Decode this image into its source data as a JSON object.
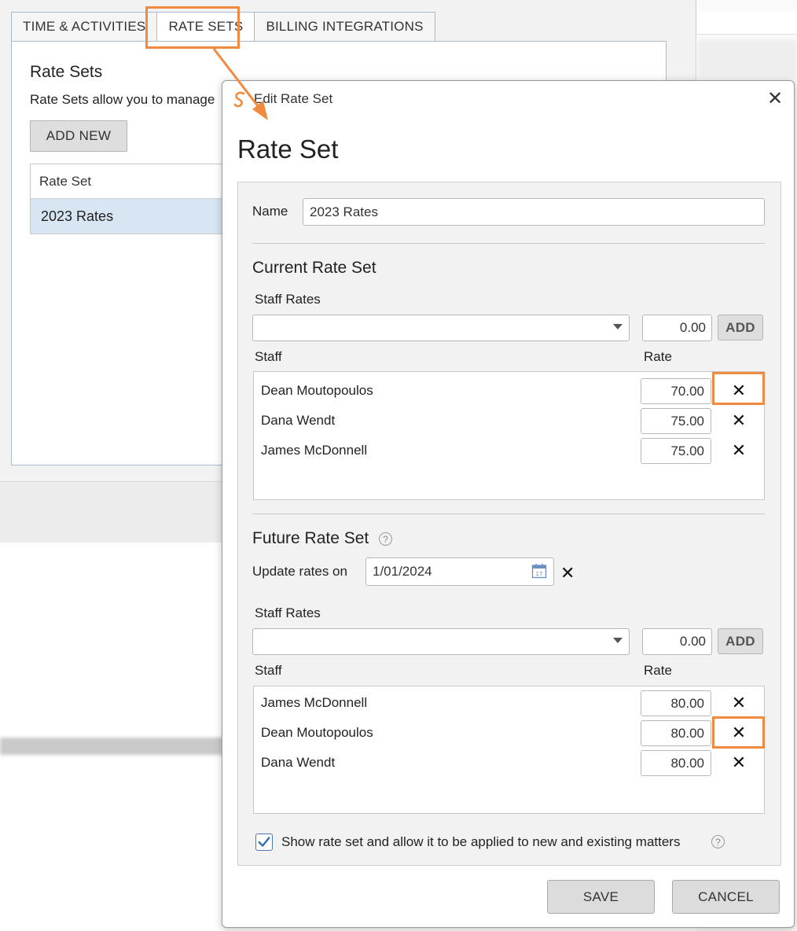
{
  "tabs": [
    "TIME & ACTIVITIES",
    "RATE SETS",
    "BILLING INTEGRATIONS"
  ],
  "panel": {
    "title": "Rate Sets",
    "description": "Rate Sets allow you to manage",
    "add_new_label": "ADD NEW",
    "table_header": "Rate Set",
    "rows": [
      "2023 Rates"
    ]
  },
  "dialog": {
    "window_title": "Edit Rate Set",
    "close_icon": "close-icon",
    "heading": "Rate Set",
    "name_label": "Name",
    "name_value": "2023 Rates",
    "current": {
      "title": "Current Rate Set",
      "staff_rates_label": "Staff Rates",
      "new_rate_value": "0.00",
      "add_label": "ADD",
      "col_staff": "Staff",
      "col_rate": "Rate",
      "rows": [
        {
          "name": "Dean Moutopoulos",
          "rate": "70.00"
        },
        {
          "name": "Dana Wendt",
          "rate": "75.00"
        },
        {
          "name": "James McDonnell",
          "rate": "75.00"
        }
      ]
    },
    "future": {
      "title": "Future Rate Set",
      "help_icon": "help-icon",
      "update_label": "Update rates on",
      "update_date": "1/01/2024",
      "staff_rates_label": "Staff Rates",
      "new_rate_value": "0.00",
      "add_label": "ADD",
      "col_staff": "Staff",
      "col_rate": "Rate",
      "rows": [
        {
          "name": "James McDonnell",
          "rate": "80.00"
        },
        {
          "name": "Dean Moutopoulos",
          "rate": "80.00"
        },
        {
          "name": "Dana Wendt",
          "rate": "80.00"
        }
      ]
    },
    "show_checkbox_label": "Show rate set and allow it to be applied to new and existing matters",
    "show_checkbox_checked": true,
    "save_label": "SAVE",
    "cancel_label": "CANCEL"
  },
  "colors": {
    "highlight": "#ef8a3e",
    "selected_row": "#d8e6f3",
    "checkbox_check": "#2f6db5"
  }
}
